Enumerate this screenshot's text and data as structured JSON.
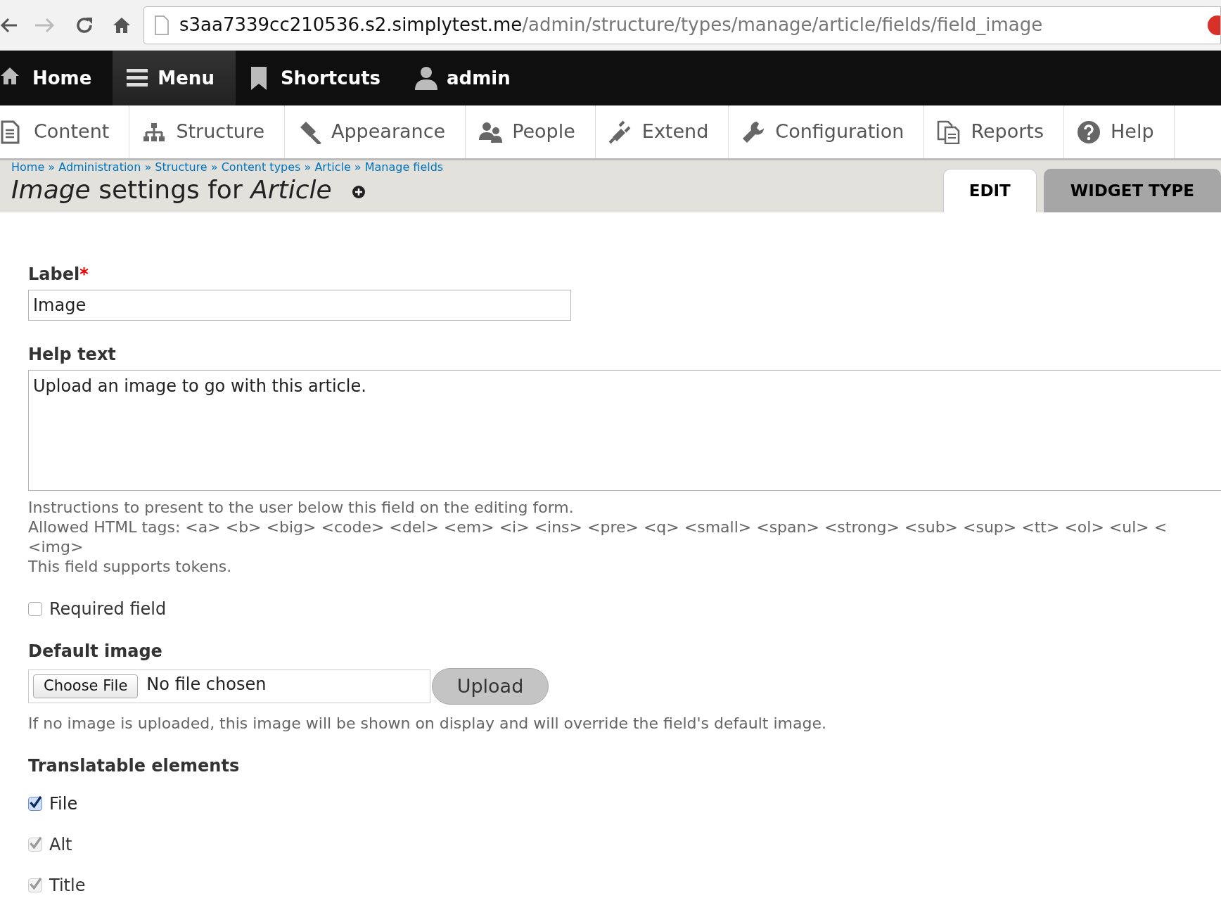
{
  "browser": {
    "url_host": "s3aa7339cc210536.s2.simplytest.me",
    "url_path": "/admin/structure/types/manage/article/fields/field_image"
  },
  "toolbar": [
    {
      "label": "Home",
      "selected": false
    },
    {
      "label": "Menu",
      "selected": true
    },
    {
      "label": "Shortcuts",
      "selected": false
    },
    {
      "label": "admin",
      "selected": false
    }
  ],
  "tray": [
    {
      "label": "Content"
    },
    {
      "label": "Structure"
    },
    {
      "label": "Appearance"
    },
    {
      "label": "People"
    },
    {
      "label": "Extend"
    },
    {
      "label": "Configuration"
    },
    {
      "label": "Reports"
    },
    {
      "label": "Help"
    }
  ],
  "breadcrumb": "Home » Administration » Structure » Content types » Article » Manage fields",
  "page_title": "*Image* settings for *Article*",
  "tabs": [
    {
      "label": "EDIT",
      "selected": true
    },
    {
      "label": "WIDGET TYPE",
      "selected": false
    }
  ],
  "form": {
    "label_field": {
      "label": "Label",
      "required_mark": "*",
      "value": "Image"
    },
    "help_field": {
      "label": "Help text",
      "value": "Upload an image to go with this article.",
      "description": [
        "Instructions to present to the user below this field on the editing form.",
        "Allowed HTML tags: <a> <b> <big> <code> <del> <em> <i> <ins> <pre> <q> <small> <span> <strong> <sub> <sup> <tt> <ol> <ul> <",
        "<img>",
        "This field supports tokens."
      ]
    },
    "required": {
      "label": "Required field",
      "checked": false
    },
    "default_image": {
      "label": "Default image",
      "choose_button": "Choose File",
      "file_status": "No file chosen",
      "upload_button": "Upload",
      "description": "If no image is uploaded, this image will be shown on display and will override the field's default image."
    },
    "translatable": {
      "label": "Translatable elements",
      "items": [
        {
          "label": "File",
          "checked": true,
          "disabled": false
        },
        {
          "label": "Alt",
          "checked": true,
          "disabled": true
        },
        {
          "label": "Title",
          "checked": true,
          "disabled": true
        }
      ]
    }
  }
}
